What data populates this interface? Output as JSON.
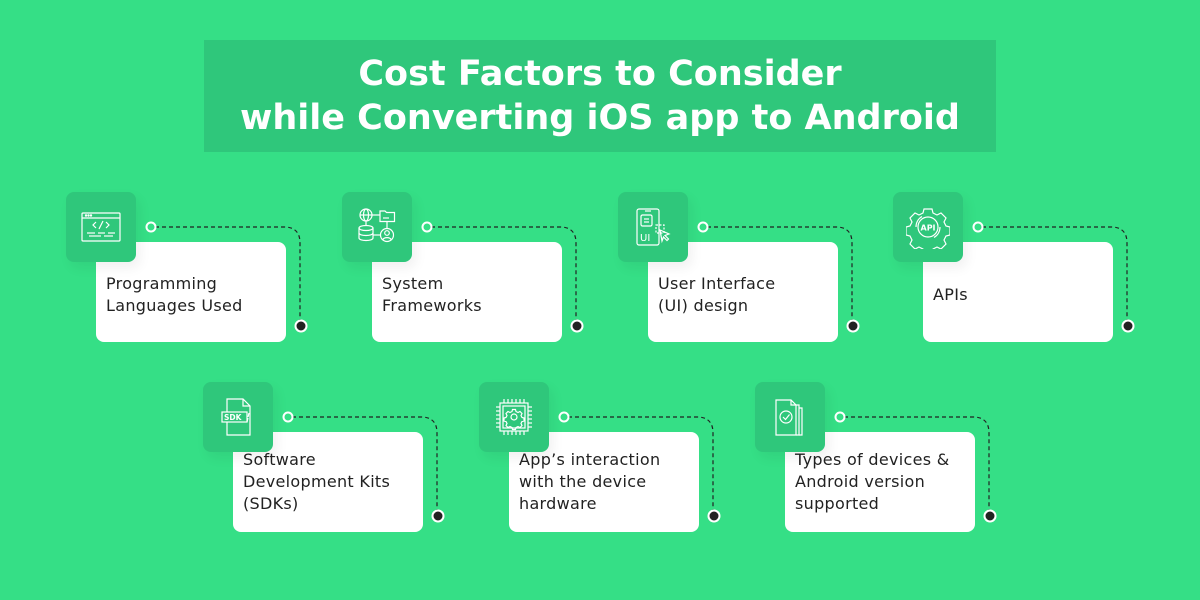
{
  "title": {
    "line1": "Cost Factors to Consider",
    "line2": "while Converting iOS app to Android"
  },
  "colors": {
    "background": "#35DF86",
    "title_box": "#2FC77B",
    "icon_box": "#2FC77B",
    "card": "#FFFFFF",
    "text": "#222222",
    "connector": "#222222"
  },
  "factors": [
    {
      "label": "Programming\nLanguages Used",
      "icon": "code-window-icon"
    },
    {
      "label": "System\nFrameworks",
      "icon": "system-network-icon"
    },
    {
      "label": "User Interface\n(UI) design",
      "icon": "ui-design-icon"
    },
    {
      "label": "APIs",
      "icon": "api-gear-icon"
    },
    {
      "label": "Software\nDevelopment Kits\n(SDKs)",
      "icon": "sdk-file-icon"
    },
    {
      "label": "App’s interaction\nwith the device\nhardware",
      "icon": "chip-gear-icon"
    },
    {
      "label": "Types of devices &\nAndroid version\nsupported",
      "icon": "verified-documents-icon"
    }
  ]
}
